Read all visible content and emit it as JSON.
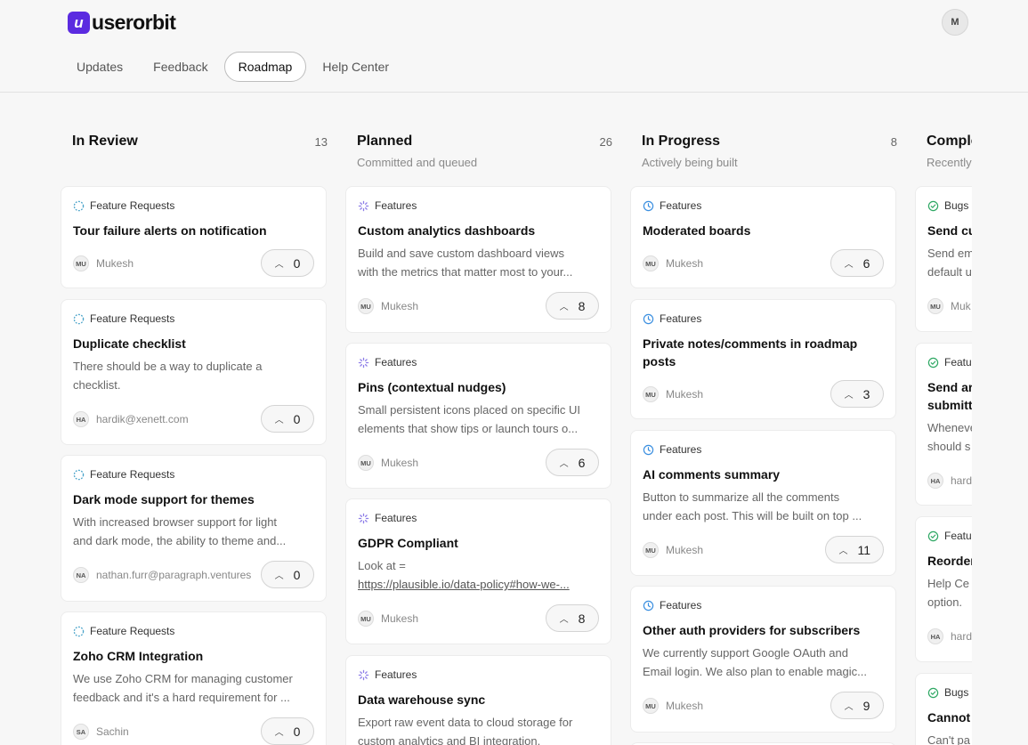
{
  "brand": {
    "mark": "u",
    "name": "userorbit"
  },
  "user": {
    "initial": "M"
  },
  "nav": [
    "Updates",
    "Feedback",
    "Roadmap",
    "Help Center"
  ],
  "columns": [
    {
      "title": "In Review",
      "count": "13",
      "subtitle": "",
      "cards": [
        {
          "category": "Feature Requests",
          "title": "Tour failure alerts on notification",
          "desc": [],
          "author_initials": "MU",
          "author": "Mukesh",
          "votes": "0"
        },
        {
          "category": "Feature Requests",
          "title": "Duplicate checklist",
          "desc": [
            "There should be a way to duplicate a",
            "checklist."
          ],
          "author_initials": "HA",
          "author": "hardik@xenett.com",
          "votes": "0"
        },
        {
          "category": "Feature Requests",
          "title": "Dark mode support for themes",
          "desc": [
            "With increased browser support for light",
            "and dark mode, the ability to theme and..."
          ],
          "author_initials": "NA",
          "author": "nathan.furr@paragraph.ventures",
          "votes": "0"
        },
        {
          "category": "Feature Requests",
          "title": "Zoho CRM Integration",
          "desc": [
            "We use Zoho CRM for managing customer",
            "feedback and it's a hard requirement for ..."
          ],
          "author_initials": "SA",
          "author": "Sachin",
          "votes": "0"
        }
      ]
    },
    {
      "title": "Planned",
      "count": "26",
      "subtitle": "Committed and queued",
      "cards": [
        {
          "category": "Features",
          "title": "Custom analytics dashboards",
          "desc": [
            "Build and save custom dashboard views",
            "with the metrics that matter most to your..."
          ],
          "author_initials": "MU",
          "author": "Mukesh",
          "votes": "8"
        },
        {
          "category": "Features",
          "title": "Pins (contextual nudges)",
          "desc": [
            "Small persistent icons placed on specific UI",
            "elements that show tips or launch tours o..."
          ],
          "author_initials": "MU",
          "author": "Mukesh",
          "votes": "6"
        },
        {
          "category": "Features",
          "title": "GDPR Compliant",
          "desc": [
            "Look at =",
            "https://plausible.io/data-policy#how-we-..."
          ],
          "author_initials": "MU",
          "author": "Mukesh",
          "votes": "8"
        },
        {
          "category": "Features",
          "title": "Data warehouse sync",
          "desc": [
            "Export raw event data to cloud storage for",
            "custom analytics and BI integration."
          ],
          "author_initials": "",
          "author": "",
          "votes": ""
        }
      ]
    },
    {
      "title": "In Progress",
      "count": "8",
      "subtitle": "Actively being built",
      "cards": [
        {
          "category": "Features",
          "title": "Moderated boards",
          "desc": [],
          "author_initials": "MU",
          "author": "Mukesh",
          "votes": "6"
        },
        {
          "category": "Features",
          "title": "Private notes/comments in roadmap posts",
          "desc": [],
          "author_initials": "MU",
          "author": "Mukesh",
          "votes": "3"
        },
        {
          "category": "Features",
          "title": "AI comments summary",
          "desc": [
            "Button to summarize all the comments",
            "under each post. This will be built on top ..."
          ],
          "author_initials": "MU",
          "author": "Mukesh",
          "votes": "11"
        },
        {
          "category": "Features",
          "title": "Other auth providers for subscribers",
          "desc": [
            "We currently support Google OAuth and",
            "Email login. We also plan to enable magic..."
          ],
          "author_initials": "MU",
          "author": "Mukesh",
          "votes": "9"
        }
      ]
    },
    {
      "title": "Comple",
      "count": "",
      "subtitle": "Recently",
      "cards": [
        {
          "category": "Bugs",
          "title": "Send cu",
          "desc": [
            "Send em",
            "default u"
          ],
          "author_initials": "MU",
          "author": "Muk",
          "votes": ""
        },
        {
          "category": "Featu",
          "title": "Send ar submitt",
          "desc": [
            "Wheneve",
            "should s"
          ],
          "author_initials": "HA",
          "author": "hard",
          "votes": ""
        },
        {
          "category": "Featu",
          "title": "Reorder",
          "desc": [
            "Help Ce",
            "option."
          ],
          "author_initials": "HA",
          "author": "hard",
          "votes": ""
        },
        {
          "category": "Bugs",
          "title": "Cannot",
          "desc": [
            "Can't pa"
          ],
          "author_initials": "",
          "author": "",
          "votes": ""
        }
      ]
    }
  ],
  "colors": {
    "brand": "#5b2be0",
    "review": "#4aa3c9",
    "planned": "#8f7fe8",
    "progress": "#3b8fe0",
    "complete": "#2fa864"
  }
}
